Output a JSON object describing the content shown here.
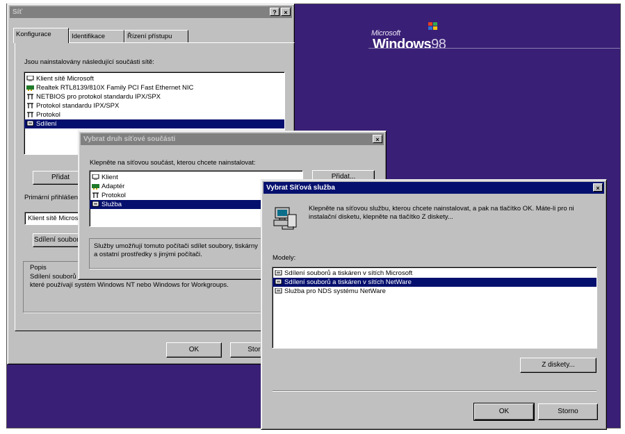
{
  "desktop": {
    "logo_microsoft": "Microsoft",
    "logo_windows": "Windows",
    "logo_version": "98",
    "colors": {
      "desktop": "#3a1f76",
      "title_active": "#05106e",
      "title_inactive": "#808080",
      "selection": "#05106e",
      "face": "#c0c0c0"
    }
  },
  "network_dialog": {
    "title": "Síť",
    "help_button": "?",
    "close_button": "×",
    "tabs": [
      "Konfigurace",
      "Identifikace",
      "Řízení přístupu"
    ],
    "installed_label": "Jsou nainstalovány následující součásti sítě:",
    "components": [
      {
        "label": "Klient sítě Microsoft",
        "icon": "client-icon"
      },
      {
        "label": "Realtek RTL8139/810X Family PCI Fast Ethernet NIC",
        "icon": "adapter-icon"
      },
      {
        "label": "NETBIOS pro protokol standardu IPX/SPX",
        "icon": "protocol-icon"
      },
      {
        "label": "Protokol standardu IPX/SPX",
        "icon": "protocol-icon"
      },
      {
        "label": "Protokol",
        "icon": "protocol-icon"
      },
      {
        "label": "Sdílení",
        "icon": "service-icon",
        "selected": true
      }
    ],
    "add_button": "Přidat",
    "primary_logon_label": "Primární přihlášení",
    "primary_logon_value": "Klient sítě Microsoft",
    "file_sharing_button": "Sdílení souborů a tiskáren",
    "description_label": "Popis",
    "description_text": "Sdílení souborů a tiskáren umožňuje sdílet soubory a tiskárny těch počítačů sítě, které používají systém Windows NT nebo Windows for Workgroups.",
    "ok_button": "OK",
    "cancel_button": "Storno"
  },
  "component_type_dialog": {
    "title": "Vybrat druh síťové součásti",
    "close_button": "×",
    "prompt": "Klepněte na síťovou součást, kterou chcete nainstalovat:",
    "types": [
      {
        "label": "Klient",
        "icon": "client-icon"
      },
      {
        "label": "Adaptér",
        "icon": "adapter-icon"
      },
      {
        "label": "Protokol",
        "icon": "protocol-icon"
      },
      {
        "label": "Služba",
        "icon": "service-icon",
        "selected": true
      }
    ],
    "add_button": "Přidat...",
    "description": "Služby umožňují tomuto počítači sdílet soubory, tiskárny a ostatní prostředky s jinými počítači."
  },
  "service_dialog": {
    "title": "Vybrat Síťová služba",
    "close_button": "×",
    "instruction": "Klepněte na síťovou službu, kterou chcete nainstalovat, a pak na tlačítko OK. Máte-li pro ni instalační disketu, klepněte na tlačítko Z diskety...",
    "models_label": "Modely:",
    "models": [
      {
        "label": "Sdílení souborů a tiskáren v sítích Microsoft",
        "icon": "service-icon"
      },
      {
        "label": "Sdílení souborů a tiskáren v sítích NetWare",
        "icon": "service-icon",
        "selected": true
      },
      {
        "label": "Služba pro NDS systému NetWare",
        "icon": "service-icon"
      }
    ],
    "have_disk_button": "Z diskety...",
    "ok_button": "OK",
    "cancel_button": "Storno"
  }
}
